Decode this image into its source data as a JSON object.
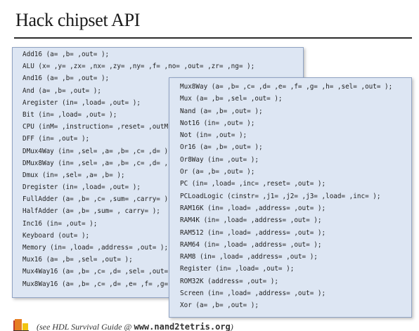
{
  "title": "Hack chipset API",
  "left_panel": {
    "lines": [
      "Add16 (a= ,b= ,out= );",
      "ALU (x= ,y= ,zx= ,nx= ,zy= ,ny= ,f= ,no= ,out= ,zr= ,ng= );",
      "And16 (a= ,b= ,out= );",
      "And (a= ,b= ,out= );",
      "Aregister (in= ,load= ,out= );",
      "Bit (in= ,load= ,out= );",
      "CPU (inM= ,instruction= ,reset= ,outM",
      "DFF (in= ,out= );",
      "DMux4Way (in= ,sel= ,a= ,b= ,c= ,d= );",
      "DMux8Way (in= ,sel= ,a= ,b= ,c= ,d= ,",
      "Dmux (in= ,sel= ,a= ,b= );",
      "Dregister (in= ,load= ,out= );",
      "FullAdder (a= ,b= ,c= ,sum= ,carry= );",
      "HalfAdder (a= ,b= ,sum= , carry= );",
      "Inc16 (in= ,out= );",
      "Keyboard (out= );",
      "Memory (in= ,load= ,address= ,out= );",
      "Mux16 (a= ,b= ,sel= ,out= );",
      "Mux4Way16 (a= ,b= ,c= ,d= ,sel= ,out=",
      "Mux8Way16 (a= ,b= ,c= ,d= ,e= ,f= ,g="
    ]
  },
  "right_panel": {
    "lines": [
      "Mux8Way (a= ,b= ,c= ,d= ,e= ,f= ,g= ,h= ,sel= ,out= );",
      "Mux (a= ,b= ,sel= ,out= );",
      "Nand (a= ,b= ,out= );",
      "Not16 (in= ,out= );",
      "Not (in= ,out= );",
      "Or16 (a= ,b= ,out= );",
      "Or8Way (in= ,out= );",
      "Or (a= ,b= ,out= );",
      "PC (in= ,load= ,inc= ,reset= ,out= );",
      "PCLoadLogic (cinstr= ,j1= ,j2= ,j3= ,load= ,inc= );",
      "RAM16K (in= ,load= ,address= ,out= );",
      "RAM4K (in= ,load= ,address= ,out= );",
      "RAM512 (in= ,load= ,address= ,out= );",
      "RAM64 (in= ,load= ,address= ,out= );",
      "RAM8 (in= ,load= ,address= ,out= );",
      "Register (in= ,load= ,out= );",
      "ROM32K (address= ,out= );",
      "Screen (in= ,load= ,address= ,out= );",
      "Xor (a= ,b= ,out= );"
    ]
  },
  "footer": {
    "icon": "book-icon",
    "text_prefix": "(see HDL Survival Guide @ ",
    "text_site": "www.nand2tetris.org",
    "text_suffix": ")"
  },
  "colors": {
    "panel_background": "#dde6f3",
    "panel_border": "#8fa2c2",
    "title_rule": "#2b2b2b"
  }
}
